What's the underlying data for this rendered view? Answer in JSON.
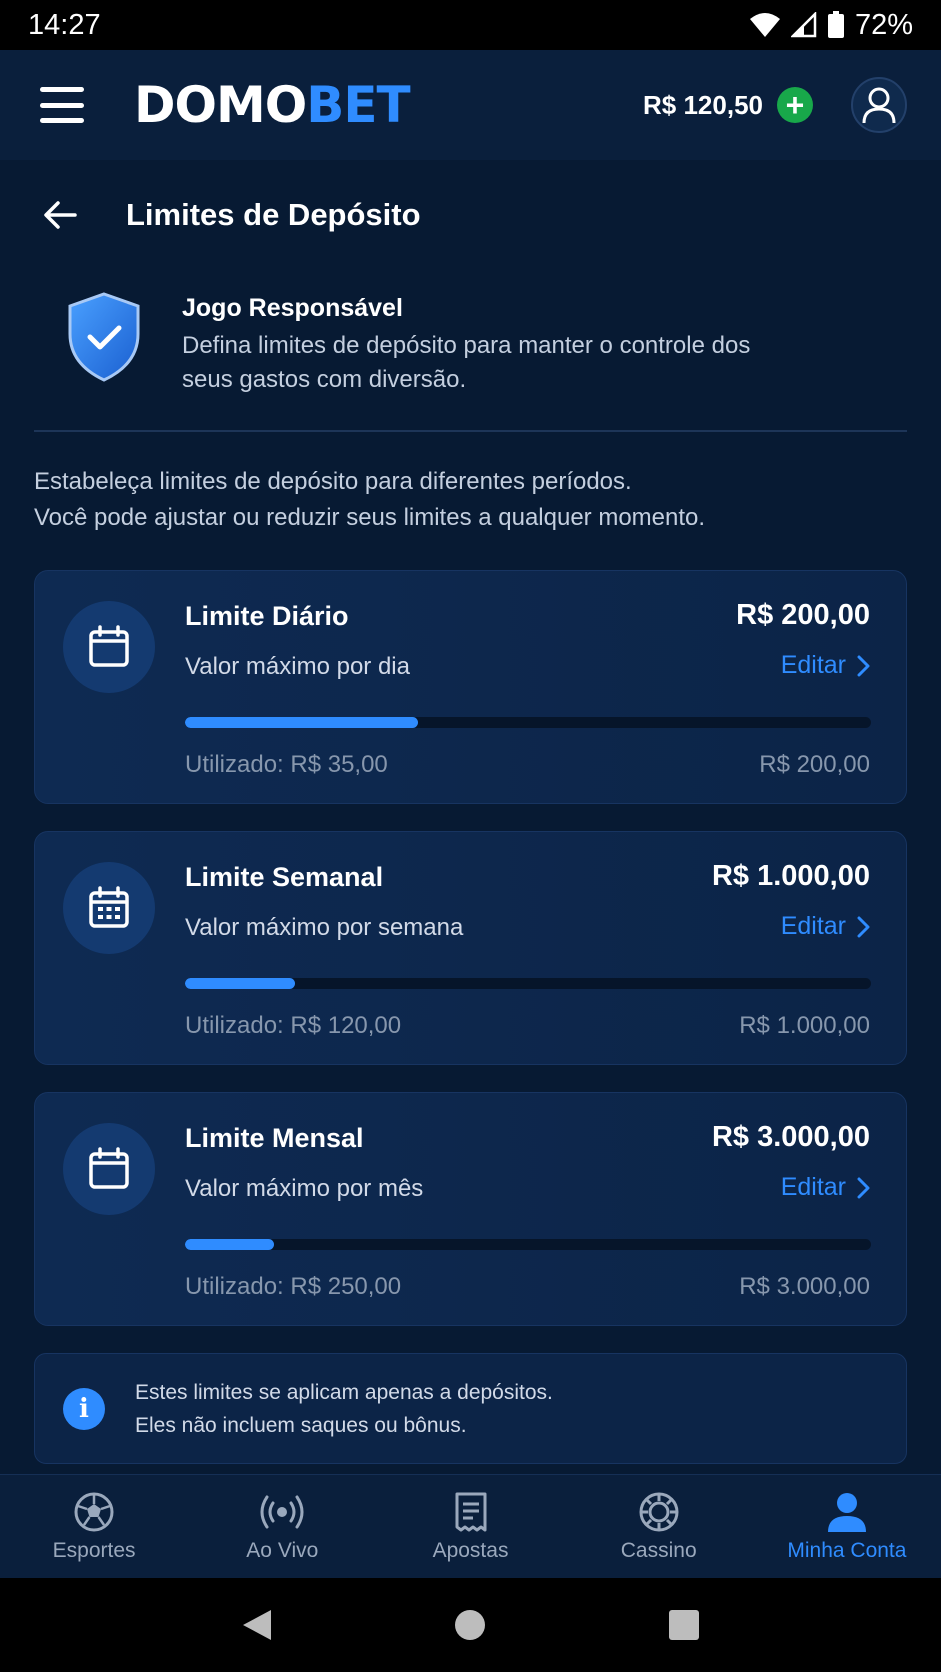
{
  "status_bar": {
    "time": "14:27",
    "battery": "72%"
  },
  "header": {
    "logo_part1": "DOMO",
    "logo_part2": "BET",
    "balance": "R$ 120,50",
    "add_label": "+"
  },
  "page": {
    "title": "Limites de Depósito"
  },
  "intro": {
    "title": "Jogo Responsável",
    "description": "Defina limites de depósito para manter o controle dos seus gastos com diversão."
  },
  "lead": {
    "line1": "Estabeleça limites de depósito para diferentes períodos.",
    "line2": "Você pode ajustar ou reduzir seus limites a qualquer momento."
  },
  "limits": [
    {
      "title": "Limite Diário",
      "subtitle": "Valor máximo por dia",
      "amount": "R$ 200,00",
      "edit_label": "Editar",
      "used": "Utilizado: R$ 35,00",
      "limit": "R$ 200,00",
      "progress": 0.34,
      "icon": "calendar-icon"
    },
    {
      "title": "Limite Semanal",
      "subtitle": "Valor máximo por semana",
      "amount": "R$ 1.000,00",
      "edit_label": "Editar",
      "used": "Utilizado: R$ 120,00",
      "limit": "R$ 1.000,00",
      "progress": 0.16,
      "icon": "calendar-grid-icon"
    },
    {
      "title": "Limite Mensal",
      "subtitle": "Valor máximo por mês",
      "amount": "R$ 3.000,00",
      "edit_label": "Editar",
      "used": "Utilizado: R$ 250,00",
      "limit": "R$ 3.000,00",
      "progress": 0.13,
      "icon": "calendar-icon"
    }
  ],
  "info": {
    "icon_glyph": "i",
    "line1": "Estes limites se aplicam apenas a depósitos.",
    "line2": "Eles não incluem saques ou bônus."
  },
  "bottom_nav": [
    {
      "label": "Esportes",
      "icon": "soccer-ball-icon",
      "active": false
    },
    {
      "label": "Ao Vivo",
      "icon": "live-broadcast-icon",
      "active": false
    },
    {
      "label": "Apostas",
      "icon": "bet-slip-icon",
      "active": false
    },
    {
      "label": "Cassino",
      "icon": "casino-chip-icon",
      "active": false
    },
    {
      "label": "Minha Conta",
      "icon": "account-icon",
      "active": true
    }
  ],
  "colors": {
    "background": "#071a33",
    "accent": "#2f8cff",
    "success": "#18a84a",
    "muted_text": "#8797ad"
  }
}
